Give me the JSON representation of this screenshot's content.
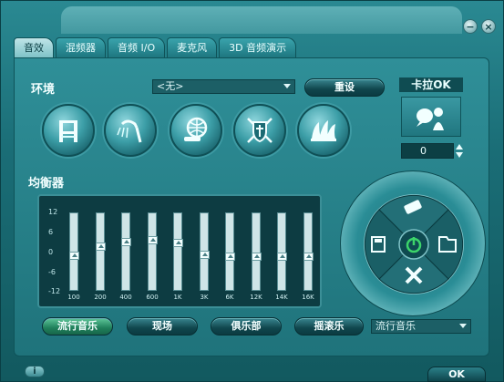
{
  "window": {
    "minimize_glyph": "−",
    "close_glyph": "×"
  },
  "tabs": [
    {
      "label": "音效",
      "active": true
    },
    {
      "label": "混频器",
      "active": false
    },
    {
      "label": "音频 I/O",
      "active": false
    },
    {
      "label": "麦克风",
      "active": false
    },
    {
      "label": "3D 音频演示",
      "active": false
    }
  ],
  "environment": {
    "label": "环境",
    "selected": "<无>",
    "reset_label": "重设",
    "icons": [
      "chair-icon",
      "shower-icon",
      "globe-pipe-icon",
      "shield-swords-icon",
      "opera-house-icon"
    ]
  },
  "karaoke": {
    "label": "卡拉OK",
    "value": "0"
  },
  "equalizer": {
    "label": "均衡器",
    "scale": [
      "12",
      "6",
      "0",
      "-6",
      "-12"
    ],
    "bands": [
      {
        "freq": "100",
        "level": 0.45
      },
      {
        "freq": "200",
        "level": 0.58
      },
      {
        "freq": "400",
        "level": 0.65
      },
      {
        "freq": "600",
        "level": 0.68
      },
      {
        "freq": "1K",
        "level": 0.64
      },
      {
        "freq": "3K",
        "level": 0.47
      },
      {
        "freq": "6K",
        "level": 0.44
      },
      {
        "freq": "12K",
        "level": 0.44
      },
      {
        "freq": "14K",
        "level": 0.44
      },
      {
        "freq": "16K",
        "level": 0.44
      }
    ]
  },
  "presets": {
    "buttons": [
      "流行音乐",
      "现场",
      "俱乐部",
      "摇滚乐"
    ],
    "active_index": 0,
    "selected": "流行音乐"
  },
  "footer": {
    "info_label": "i",
    "ok_label": "OK"
  },
  "colors": {
    "accent": "#2a8992",
    "active_pill": "#1f7f5a",
    "power_green": "#3cd46a"
  }
}
